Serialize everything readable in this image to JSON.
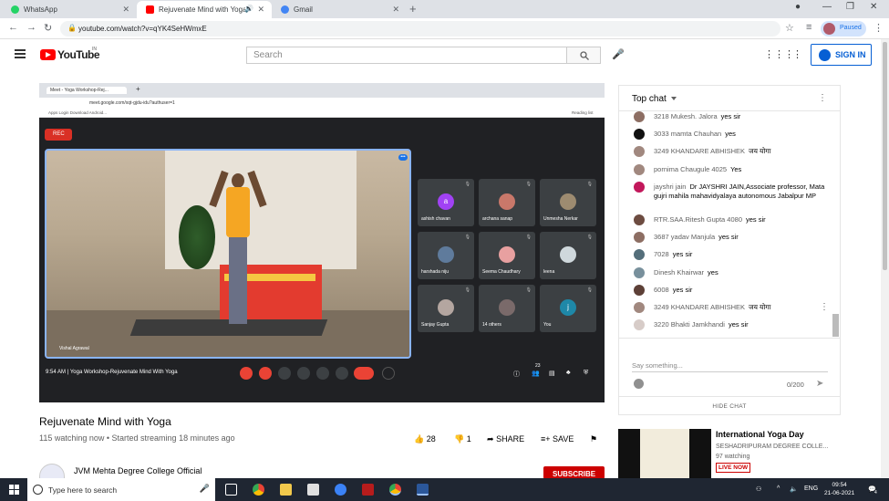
{
  "browser": {
    "tabs": [
      {
        "label": "WhatsApp",
        "color": "#25d366"
      },
      {
        "label": "Rejuvenate Mind with Yoga",
        "color": "#ff0000"
      },
      {
        "label": "Gmail",
        "color": "#4285f4"
      }
    ],
    "url": "youtube.com/watch?v=qYK4SeHWmxE",
    "profile_status": "Paused"
  },
  "youtube": {
    "logo_text": "YouTube",
    "region": "IN",
    "search_placeholder": "Search",
    "signin_label": "SIGN IN"
  },
  "video": {
    "meet_url": "meet.google.com/xqt-gjdu-idu?authuser=1",
    "meet_tab": "Meet - Yoga Workshop-Rej...",
    "bookmarks": "Apps   Login   Download Android...",
    "reading_list": "Reading list",
    "rec_label": "REC",
    "host_name": "Vishal Agrawal",
    "participants": [
      {
        "name": "ashish chavan",
        "initial": "a",
        "color": "#a142f4"
      },
      {
        "name": "archana sanap",
        "initial": "",
        "color": "#c9786a"
      },
      {
        "name": "Unmesha Nerkar",
        "initial": "",
        "color": "#9d8b70"
      },
      {
        "name": "harshada niju",
        "initial": "",
        "color": "#5f7b9c"
      },
      {
        "name": "Seema Chaudhary",
        "initial": "",
        "color": "#e8a0a0"
      },
      {
        "name": "leena",
        "initial": "",
        "color": "#cfd8dc"
      },
      {
        "name": "Sanjay Gupta",
        "initial": "",
        "color": "#b4a6a0"
      },
      {
        "name": "14 others",
        "initial": "",
        "color": "#7a6a6a"
      },
      {
        "name": "You",
        "initial": "j",
        "color": "#1e88a8"
      }
    ],
    "meet_time": "9:54 AM",
    "meet_title": "Yoga Workshop-Rejuvenate Mind With Yoga",
    "people_count": "23"
  },
  "details": {
    "title": "Rejuvenate Mind with Yoga",
    "meta": "115 watching now • Started streaming 18 minutes ago",
    "likes": "28",
    "dislikes": "1",
    "share_label": "SHARE",
    "save_label": "SAVE",
    "channel_name": "JVM Mehta Degree College Official",
    "subscribe_label": "SUBSCRIBE"
  },
  "chat": {
    "title": "Top chat",
    "messages": [
      {
        "author": "3218 Mukesh. Jalora",
        "text": "yes sir",
        "color": "#8d6e63"
      },
      {
        "author": "3033 mamta Chauhan",
        "text": "yes",
        "color": "#111111"
      },
      {
        "author": "3249 KHANDARE ABHISHEK",
        "text": "जय योगा",
        "color": "#a1887f"
      },
      {
        "author": "pornima Chaugule 4025",
        "text": "Yes",
        "color": "#a1887f"
      },
      {
        "author": "jayshri jain",
        "text": "Dr JAYSHRI JAIN,Associate professor, Mata gujri mahila mahavidyalaya autonomous Jabalpur MP",
        "color": "#c2185b"
      },
      {
        "author": "RTR.SAA.Ritesh Gupta 4080",
        "text": "yes sir",
        "color": "#6d4c41"
      },
      {
        "author": "3687 yadav Manjula",
        "text": "yes sir",
        "color": "#8d6e63"
      },
      {
        "author": "7028",
        "text": "yes sir",
        "color": "#546e7a"
      },
      {
        "author": "Dinesh Khairwar",
        "text": "yes",
        "color": "#78909c"
      },
      {
        "author": "6008",
        "text": "yes sir",
        "color": "#5d4037"
      },
      {
        "author": "3249 KHANDARE ABHISHEK",
        "text": "जय योगा",
        "color": "#a1887f"
      },
      {
        "author": "3220 Bhakti Jamkhandi",
        "text": "yes sir",
        "color": "#d7ccc8"
      }
    ],
    "input_placeholder": "Say something...",
    "char_count": "0/200",
    "hide_label": "HIDE CHAT"
  },
  "recommendation": {
    "title": "International Yoga Day",
    "channel": "SESHADRIPURAM DEGREE COLLE...",
    "watching": "97 watching",
    "badge": "LIVE NOW"
  },
  "taskbar": {
    "search_placeholder": "Type here to search",
    "language": "ENG",
    "time": "09:54",
    "date": "21-06-2021",
    "notification_count": "4"
  }
}
